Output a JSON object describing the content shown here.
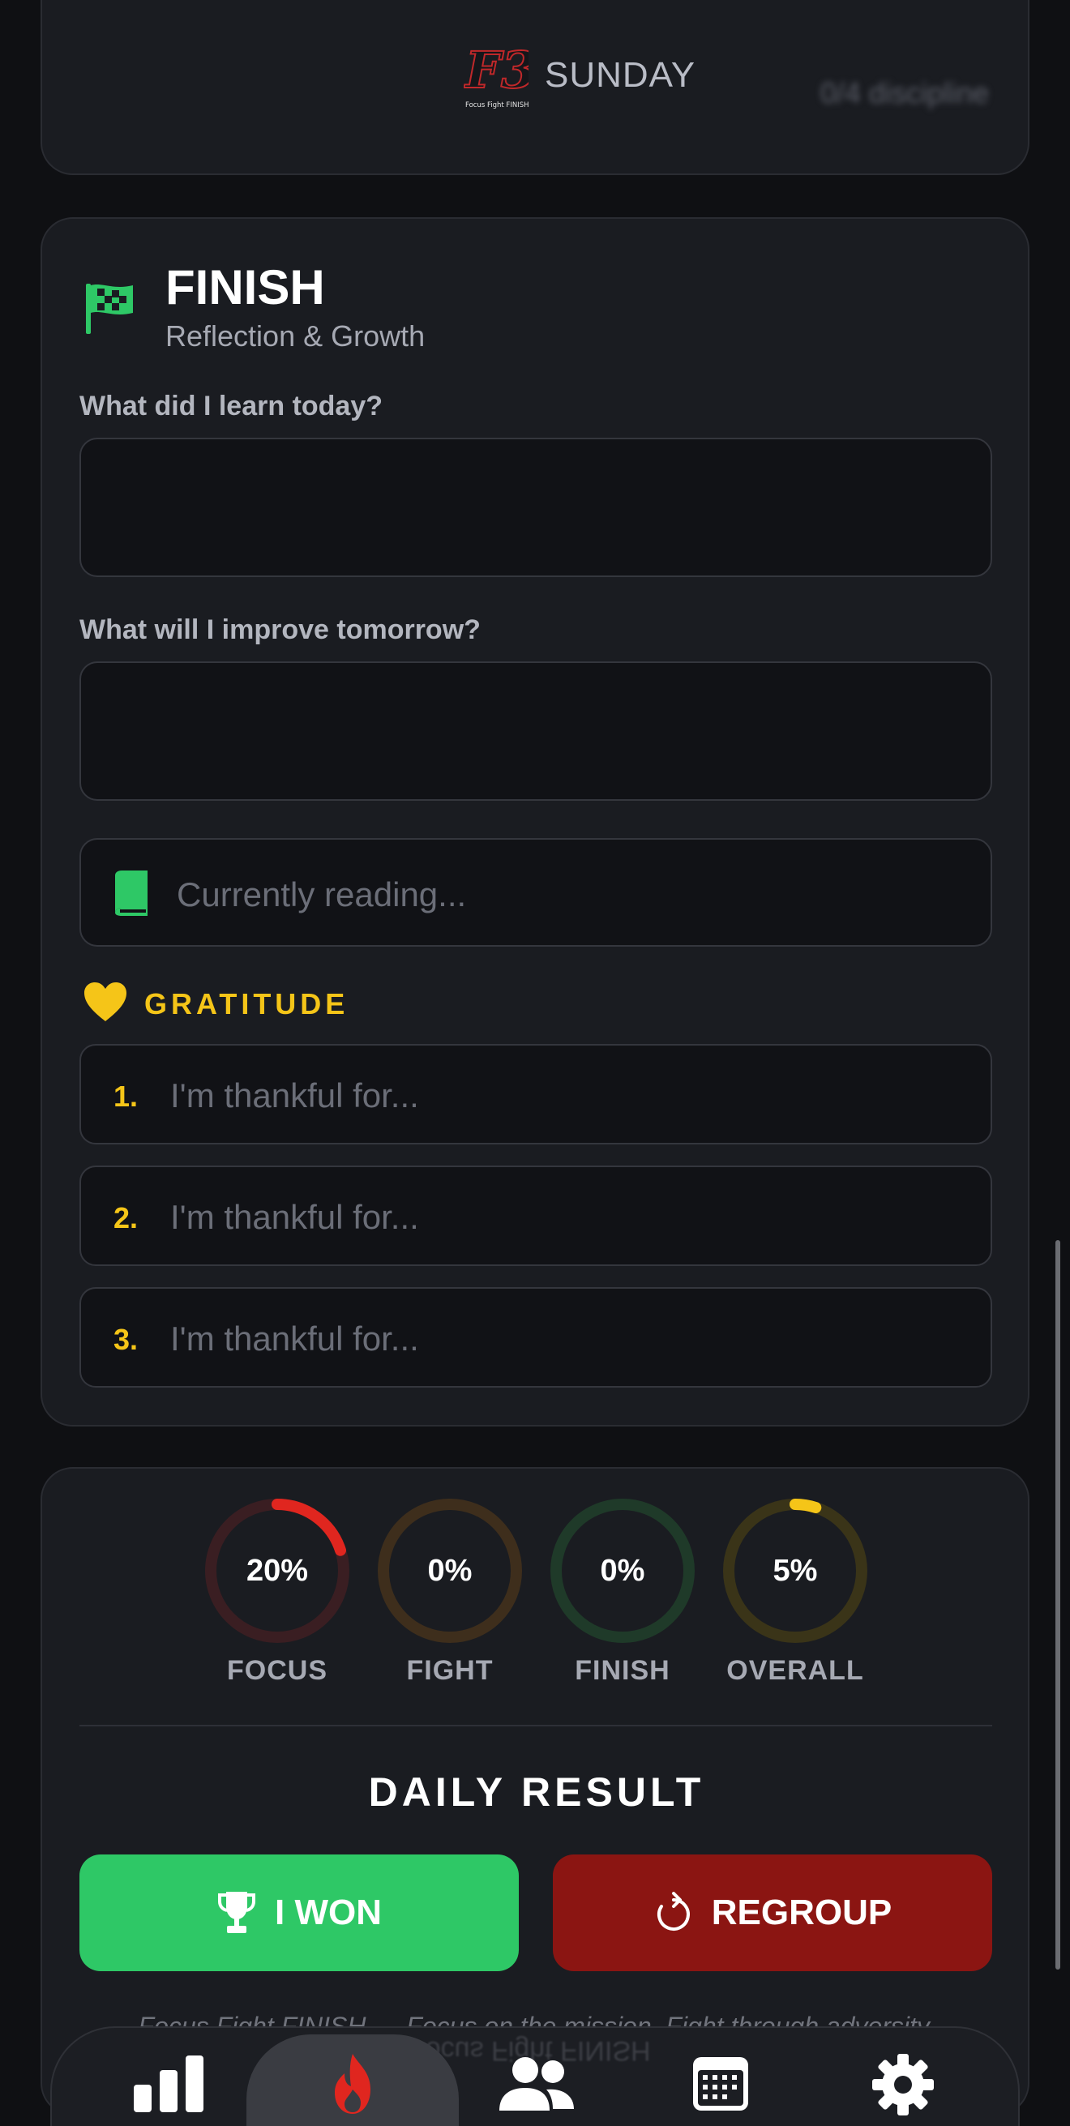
{
  "header": {
    "logo_text": "F3",
    "logo_tagline": "Focus Fight FINISH",
    "day": "SUNDAY",
    "discipline": "0/4 discipline"
  },
  "finish": {
    "title": "FINISH",
    "subtitle": "Reflection & Growth",
    "q1_label": "What did I learn today?",
    "q1_value": "",
    "q2_label": "What will I improve tomorrow?",
    "q2_value": "",
    "reading_placeholder": "Currently reading...",
    "gratitude_label": "GRATITUDE",
    "gratitude": [
      {
        "num": "1.",
        "placeholder": "I'm thankful for..."
      },
      {
        "num": "2.",
        "placeholder": "I'm thankful for..."
      },
      {
        "num": "3.",
        "placeholder": "I'm thankful for..."
      }
    ]
  },
  "results": {
    "rings": [
      {
        "label": "FOCUS",
        "value": "20%",
        "fraction": 0.2,
        "color": "#e0261f",
        "track": "#3a1e22"
      },
      {
        "label": "FIGHT",
        "value": "0%",
        "fraction": 0.0,
        "color": "#e08a1f",
        "track": "#3e2e1c"
      },
      {
        "label": "FINISH",
        "value": "0%",
        "fraction": 0.0,
        "color": "#2ec866",
        "track": "#1f3a29"
      },
      {
        "label": "OVERALL",
        "value": "5%",
        "fraction": 0.05,
        "color": "#f5c518",
        "track": "#3a3418"
      }
    ],
    "daily_result": "DAILY RESULT",
    "won_label": "I WON",
    "regroup_label": "REGROUP",
    "motto": "Focus Fight FINISH — Focus on the mission. Fight through adversity."
  },
  "nav": {
    "mirror_text": "Focus Fight FINISH",
    "items": [
      {
        "icon": "bar-chart-icon"
      },
      {
        "icon": "flame-icon",
        "active": true
      },
      {
        "icon": "users-icon"
      },
      {
        "icon": "calendar-icon"
      },
      {
        "icon": "gear-icon"
      }
    ]
  },
  "colors": {
    "accent_green": "#2ec866",
    "accent_red": "#e0261f",
    "accent_gold": "#f5c518",
    "background": "#0f1013"
  }
}
